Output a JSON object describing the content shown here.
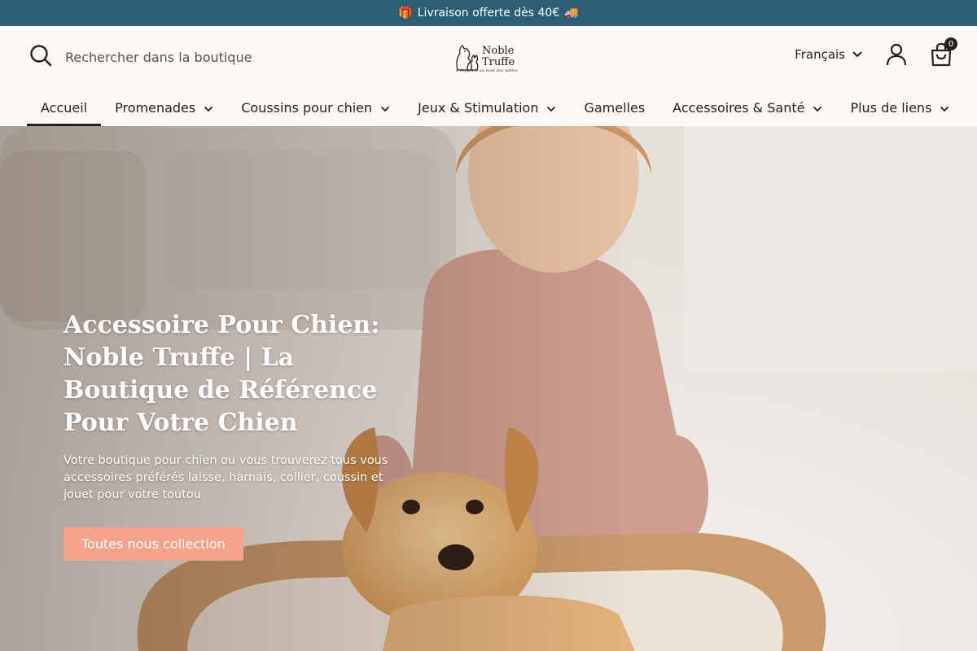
{
  "announcement": {
    "gift_icon": "🎁",
    "text": "Livraison offerte dès 40€",
    "truck_icon": "🚚"
  },
  "header": {
    "search": {
      "placeholder": "Rechercher dans la boutique",
      "icon": "search-icon"
    },
    "logo": {
      "name_line1": "Noble",
      "name_line2": "Truffe",
      "tagline": "L'élégance au bout des pattes"
    },
    "language": "Français",
    "cart_count": "0"
  },
  "nav": {
    "items": [
      {
        "label": "Accueil",
        "active": true,
        "dropdown": false
      },
      {
        "label": "Promenades",
        "active": false,
        "dropdown": true
      },
      {
        "label": "Coussins pour chien",
        "active": false,
        "dropdown": true
      },
      {
        "label": "Jeux & Stimulation",
        "active": false,
        "dropdown": true
      },
      {
        "label": "Gamelles",
        "active": false,
        "dropdown": false
      },
      {
        "label": "Accessoires & Santé",
        "active": false,
        "dropdown": true
      },
      {
        "label": "Plus de liens",
        "active": false,
        "dropdown": true
      }
    ]
  },
  "hero": {
    "title": "Accessoire Pour Chien: Noble Truffe | La Boutique de Référence Pour Votre Chien",
    "subtitle": "Votre boutique pour chien ou vous trouverez tous vous accessoires préférés laisse, harnais, collier, coussin et jouet pour votre toutou",
    "cta": "Toutes nous collection"
  },
  "colors": {
    "announce_bg": "#2b5f73",
    "cta_bg": "#f4a28c",
    "page_bg": "#fdf9f4"
  }
}
